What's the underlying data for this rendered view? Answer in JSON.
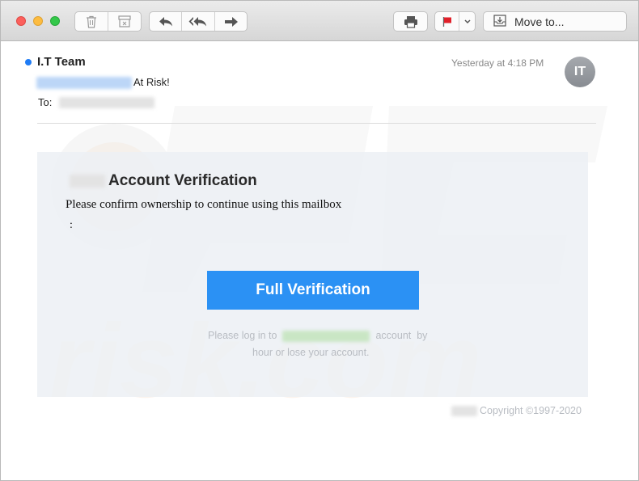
{
  "toolbar": {
    "move_to_label": "Move to..."
  },
  "message": {
    "sender": "I.T Team",
    "date": "Yesterday at 4:18 PM",
    "avatar_initials": "IT",
    "subject_suffix": "At Risk!",
    "to_label": "To:"
  },
  "body": {
    "heading": "Account Verification",
    "text": "Please confirm ownership to continue using this mailbox",
    "colon": ":",
    "button_label": "Full Verification",
    "footnote_part1": "Please log in to",
    "footnote_part2": " account  by",
    "footnote_line2": "hour or lose your account.",
    "copyright": "Copyright ©1997-2020"
  },
  "colors": {
    "accent": "#2b91f4",
    "unread": "#1f7cf5",
    "flag": "#e0202a"
  },
  "icons": [
    "trash-icon",
    "archive-icon",
    "reply-icon",
    "reply-all-icon",
    "forward-icon",
    "print-icon",
    "flag-icon",
    "chevron-down-icon",
    "move-to-icon"
  ]
}
